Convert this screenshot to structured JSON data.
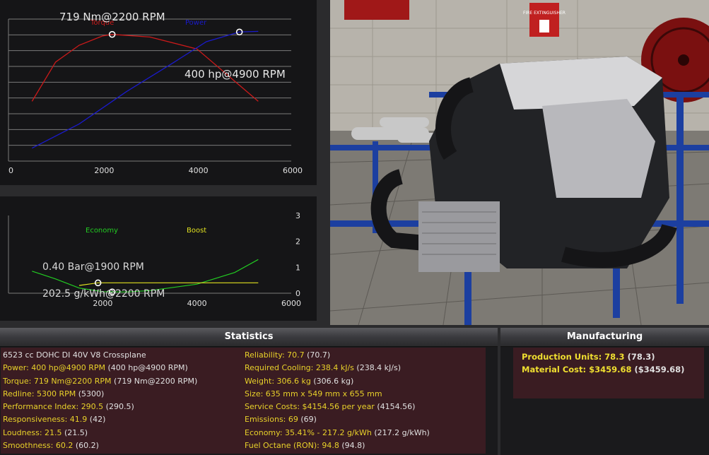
{
  "top_chart": {
    "type": "line",
    "x_ticks": [
      "0",
      "2000",
      "4000",
      "6000"
    ],
    "xlim": [
      0,
      6000
    ],
    "legend": {
      "torque": "Torque",
      "power": "Power"
    },
    "torque_annotation": "719 Nm@2200 RPM",
    "power_annotation": "400 hp@4900 RPM",
    "colors": {
      "torque": "#cc1a1a",
      "power": "#1a1acc",
      "grid": "#7a7a7a"
    },
    "torque_series": [
      [
        500,
        540
      ],
      [
        1000,
        645
      ],
      [
        1500,
        690
      ],
      [
        2000,
        715
      ],
      [
        2200,
        719
      ],
      [
        3000,
        712
      ],
      [
        4000,
        680
      ],
      [
        5300,
        540
      ]
    ],
    "power_series": [
      [
        500,
        40
      ],
      [
        1500,
        115
      ],
      [
        2500,
        215
      ],
      [
        3500,
        305
      ],
      [
        4200,
        370
      ],
      [
        4900,
        400
      ],
      [
        5300,
        402
      ]
    ],
    "torque_peak": [
      2200,
      719
    ],
    "power_peak": [
      4900,
      400
    ]
  },
  "bottom_chart": {
    "type": "line",
    "x_ticks": [
      "2000",
      "4000",
      "6000"
    ],
    "y_ticks": [
      "0",
      "1",
      "2",
      "3"
    ],
    "xlim": [
      0,
      6000
    ],
    "ylim": [
      0,
      3
    ],
    "legend": {
      "economy": "Economy",
      "boost": "Boost"
    },
    "boost_annotation": "0.40 Bar@1900 RPM",
    "economy_annotation": "202.5 g/kWh@2200 RPM",
    "colors": {
      "economy": "#22cc22",
      "boost": "#e0e020"
    },
    "economy_series": [
      [
        500,
        0.85
      ],
      [
        1000,
        0.55
      ],
      [
        1500,
        0.2
      ],
      [
        2000,
        0.06
      ],
      [
        2500,
        0.05
      ],
      [
        3000,
        0.1
      ],
      [
        4000,
        0.35
      ],
      [
        4800,
        0.8
      ],
      [
        5300,
        1.3
      ]
    ],
    "boost_series": [
      [
        1500,
        0.3
      ],
      [
        1900,
        0.4
      ],
      [
        3000,
        0.4
      ],
      [
        5300,
        0.4
      ]
    ],
    "boost_peak": [
      1900,
      0.4
    ],
    "economy_peak": [
      2200,
      0.05
    ]
  },
  "statistics": {
    "title": "Statistics",
    "left": [
      {
        "label": "6523 cc DOHC DI 40V V8 Crossplane",
        "base": "",
        "plain": true
      },
      {
        "label": "Power: 400 hp@4900 RPM",
        "base": " (400 hp@4900 RPM)"
      },
      {
        "label": "Torque: 719 Nm@2200 RPM",
        "base": " (719 Nm@2200 RPM)"
      },
      {
        "label": "Redline: 5300 RPM",
        "base": " (5300)"
      },
      {
        "label": "Performance Index: 290.5",
        "base": " (290.5)"
      },
      {
        "label": "Responsiveness: 41.9",
        "base": " (42)"
      },
      {
        "label": "Loudness: 21.5",
        "base": " (21.5)"
      },
      {
        "label": "Smoothness: 60.2",
        "base": " (60.2)"
      }
    ],
    "right": [
      {
        "label": "Reliability: 70.7",
        "base": " (70.7)"
      },
      {
        "label": "Required Cooling: 238.4 kJ/s",
        "base": " (238.4 kJ/s)"
      },
      {
        "label": "Weight: 306.6 kg",
        "base": " (306.6 kg)"
      },
      {
        "label": "Size: 635 mm x 549 mm x 655 mm",
        "base": ""
      },
      {
        "label": "Service Costs: $4154.56 per year",
        "base": " (4154.56)"
      },
      {
        "label": "Emissions: 69",
        "base": " (69)"
      },
      {
        "label": "Economy: 35.41% - 217.2 g/kWh",
        "base": " (217.2 g/kWh)"
      },
      {
        "label": "Fuel Octane (RON): 94.8",
        "base": " (94.8)"
      }
    ]
  },
  "manufacturing": {
    "title": "Manufacturing",
    "rows": [
      {
        "label": "Production Units: 78.3",
        "base": " (78.3)"
      },
      {
        "label": "Material Cost: $3459.68",
        "base": " ($3459.68)"
      }
    ]
  },
  "scene": {
    "fire_sign": "FIRE EXTINGUISHER"
  }
}
